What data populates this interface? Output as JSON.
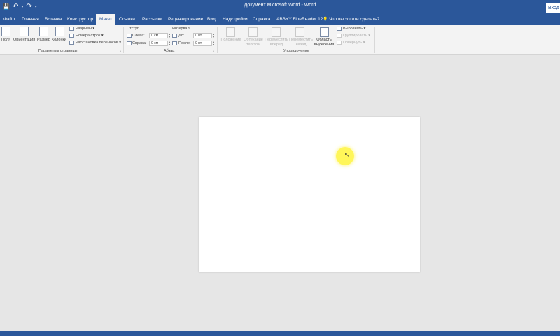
{
  "title_bar": {
    "document_title": "Документ Microsoft Word  -  Word",
    "signin_label": "Вход"
  },
  "tabs": [
    {
      "label": "Файл",
      "active": false
    },
    {
      "label": "Главная",
      "active": false
    },
    {
      "label": "Вставка",
      "active": false
    },
    {
      "label": "Конструктор",
      "active": false
    },
    {
      "label": "Макет",
      "active": true
    },
    {
      "label": "Ссылки",
      "active": false
    },
    {
      "label": "Рассылки",
      "active": false
    },
    {
      "label": "Рецензирование",
      "active": false
    },
    {
      "label": "Вид",
      "active": false
    },
    {
      "label": "Надстройки",
      "active": false
    },
    {
      "label": "Справка",
      "active": false
    },
    {
      "label": "ABBYY FineReader 12",
      "active": false
    }
  ],
  "tell_me": "Что вы хотите сделать?",
  "ribbon": {
    "page_setup": {
      "margins": "Поля",
      "orientation": "Ориентация",
      "size": "Размер",
      "columns": "Колонки",
      "breaks": "Разрывы ▾",
      "line_numbers": "Номера строк ▾",
      "hyphenation": "Расстановка переносов ▾",
      "group_label": "Параметры страницы"
    },
    "paragraph": {
      "indent_heading": "Отступ",
      "left_label": "Слева:",
      "left_value": "0 см",
      "right_label": "Справа:",
      "right_value": "0 см",
      "spacing_heading": "Интервал",
      "before_label": "До:",
      "before_value": "0 пт",
      "after_label": "После:",
      "after_value": "0 пт",
      "group_label": "Абзац"
    },
    "arrange": {
      "position": "Положение",
      "wrap_text": "Обтекание текстом",
      "bring_forward": "Переместить вперед",
      "send_backward": "Переместить назад",
      "selection_pane": "Область выделения",
      "align": "Выровнять ▾",
      "group": "Группировать ▾",
      "rotate": "Повернуть ▾",
      "group_label": "Упорядочение"
    }
  },
  "icons": {
    "save": "💾",
    "undo": "↶",
    "redo": "↷",
    "dropdown": "▾",
    "launcher": "⌟",
    "bulb": "💡",
    "pointer": "↖"
  }
}
